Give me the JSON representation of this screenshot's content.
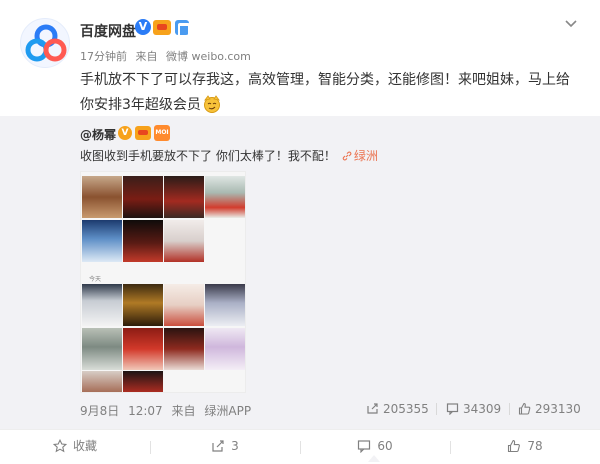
{
  "post": {
    "author": "百度网盘",
    "time": "17分钟前",
    "source_prefix": "来自",
    "source": "微博 weibo.com",
    "text_line1": "手机放不下了可以存我这，高效管理，智能分类，还能修图！来吧姐妹，马上给",
    "text_line2": "你安排3年超级会员",
    "badges": [
      "verified-blue-v",
      "vip-crown",
      "lock"
    ],
    "colors": {
      "brand": "#2b7cf6",
      "link": "#eb7350",
      "muted": "#808080"
    }
  },
  "repost": {
    "author": "@杨幂",
    "rank_badge": "MOI",
    "text": "收图收到手机要放不下了 你们太棒了！我不配！",
    "link_label": "绿洲",
    "image": {
      "section_label": "今天"
    },
    "date": "9月8日",
    "clock": "12:07",
    "source_prefix": "来自",
    "source": "绿洲APP",
    "reposts": "205355",
    "comments": "34309",
    "likes": "293130"
  },
  "actions": {
    "favorite": "收藏",
    "repost": "3",
    "comment": "60",
    "like": "78"
  }
}
